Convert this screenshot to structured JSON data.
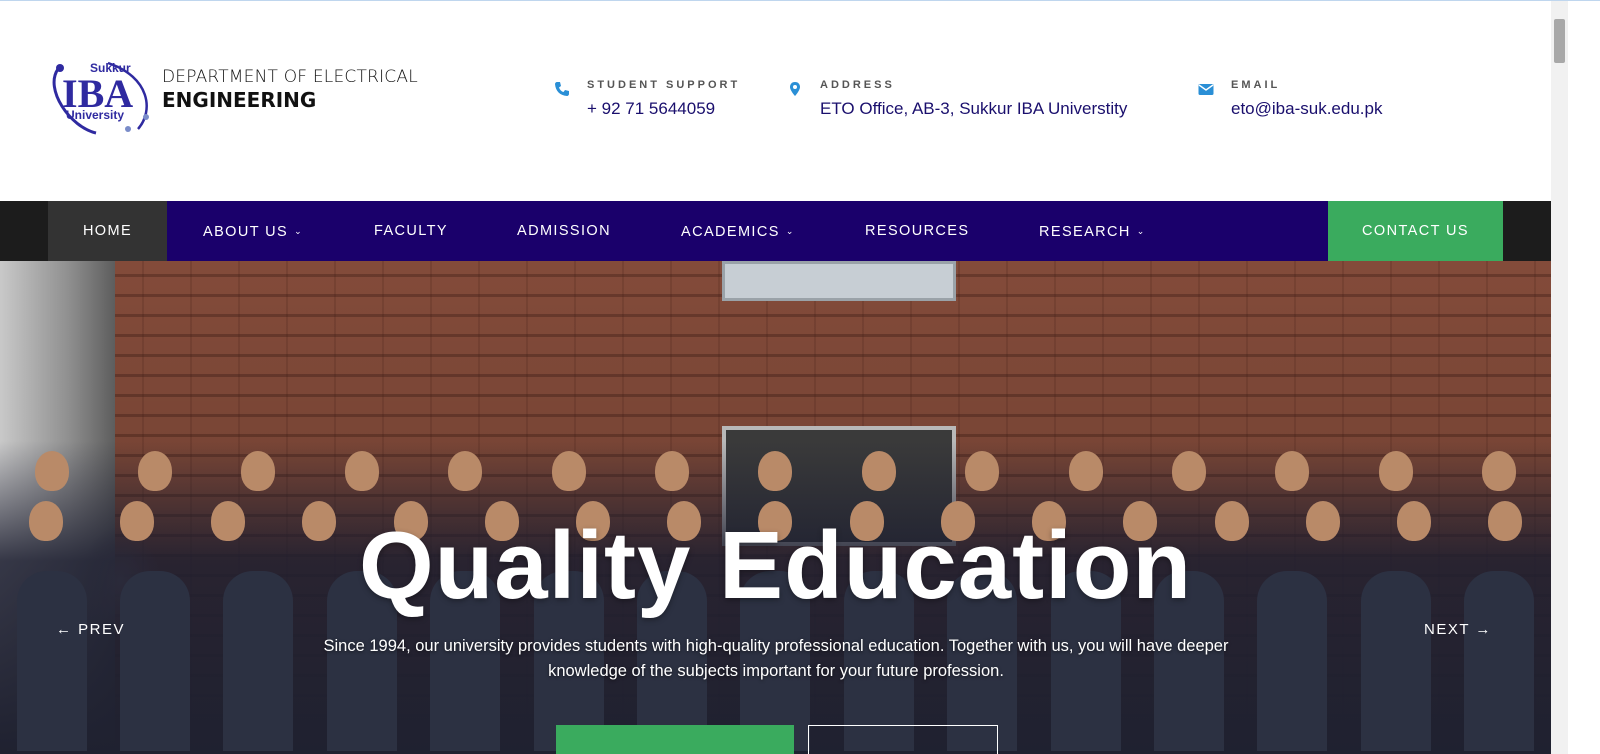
{
  "header": {
    "dept_line1": "DEPARTMENT OF ELECTRICAL",
    "dept_line2": "ENGINEERING",
    "logo_text_top": "Sukkur",
    "logo_text_main": "IBA",
    "logo_text_bottom": "University",
    "support": {
      "label": "STUDENT SUPPORT",
      "value": "+ 92 71 5644059",
      "icon": "phone-icon"
    },
    "address": {
      "label": "ADDRESS",
      "value": "ETO Office, AB-3, Sukkur IBA Universtity",
      "icon": "map-pin-icon"
    },
    "email": {
      "label": "EMAIL",
      "value": "eto@iba-suk.edu.pk",
      "icon": "envelope-icon"
    }
  },
  "nav": {
    "items": [
      {
        "label": "HOME",
        "has_dropdown": false
      },
      {
        "label": "ABOUT US",
        "has_dropdown": true
      },
      {
        "label": "FACULTY",
        "has_dropdown": false
      },
      {
        "label": "ADMISSION",
        "has_dropdown": false
      },
      {
        "label": "ACADEMICS",
        "has_dropdown": true
      },
      {
        "label": "RESOURCES",
        "has_dropdown": false
      },
      {
        "label": "RESEARCH",
        "has_dropdown": true
      },
      {
        "label": "CONTACT US",
        "has_dropdown": false
      }
    ],
    "caret": "⌄"
  },
  "hero": {
    "title": "Quality Education",
    "text": "Since 1994, our university provides students with high-quality professional education. Together with us, you will have deeper knowledge of the subjects important for your future profession.",
    "prev_label": "PREV",
    "next_label": "NEXT",
    "prev_arrow": "←",
    "next_arrow": "→"
  },
  "colors": {
    "nav_bg": "#1a006b",
    "nav_home_bg": "#333333",
    "accent_green": "#3aab5e",
    "info_text": "#1a0f6d",
    "icon_blue": "#2a8fd6"
  }
}
